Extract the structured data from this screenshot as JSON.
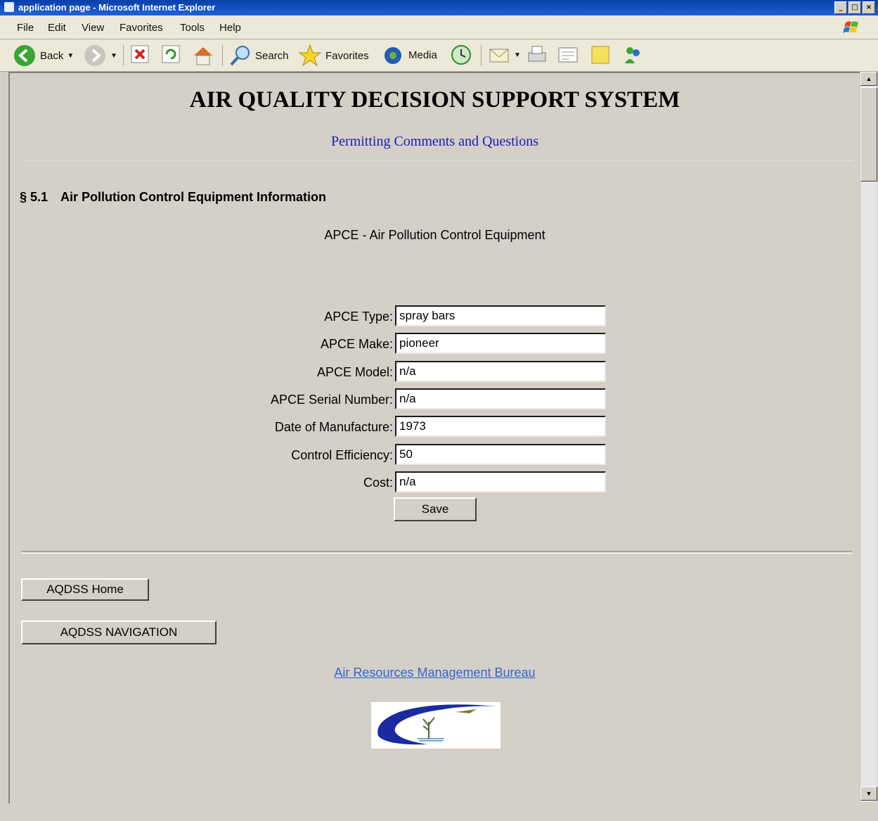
{
  "window": {
    "title": "application page - Microsoft Internet Explorer"
  },
  "menubar": {
    "items": [
      "File",
      "Edit",
      "View",
      "Favorites",
      "Tools",
      "Help"
    ]
  },
  "toolbar": {
    "back": "Back",
    "search": "Search",
    "favorites": "Favorites",
    "media": "Media"
  },
  "page": {
    "title": "AIR QUALITY DECISION SUPPORT SYSTEM",
    "subtitle_link": "Permitting Comments and Questions",
    "section_number": "§ 5.1",
    "section_title": "Air Pollution Control Equipment Information",
    "caption": "APCE - Air Pollution Control Equipment"
  },
  "form": {
    "fields": [
      {
        "label": "APCE Type:",
        "value": "spray bars"
      },
      {
        "label": "APCE Make:",
        "value": "pioneer"
      },
      {
        "label": "APCE Model:",
        "value": "n/a"
      },
      {
        "label": "APCE Serial Number:",
        "value": "n/a"
      },
      {
        "label": "Date of Manufacture:",
        "value": "1973"
      },
      {
        "label": "Control Efficiency:",
        "value": "50"
      },
      {
        "label": "Cost:",
        "value": "n/a"
      }
    ],
    "save_label": "Save"
  },
  "nav": {
    "home_label": "AQDSS Home",
    "navigation_label": "AQDSS NAVIGATION",
    "bureau_link": "Air Resources Management Bureau"
  }
}
